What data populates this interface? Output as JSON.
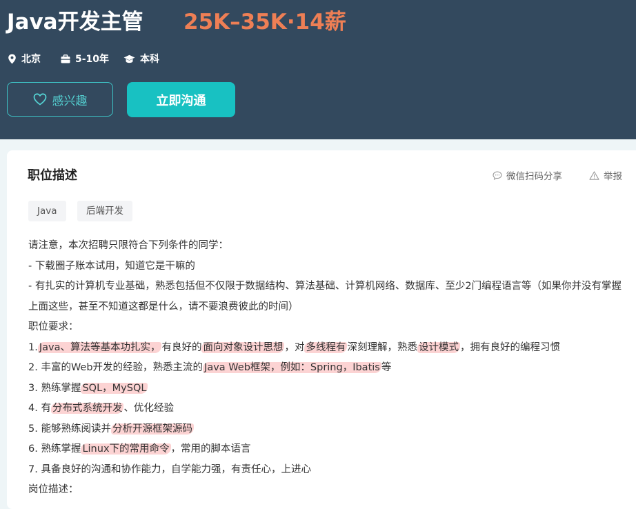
{
  "job": {
    "title": "Java开发主管",
    "salary": "25K–35K·14薪",
    "city": "北京",
    "experience": "5-10年",
    "education": "本科"
  },
  "buttons": {
    "interest_label": "感兴趣",
    "chat_label": "立即沟通"
  },
  "description": {
    "section_title": "职位描述",
    "share_label": "微信扫码分享",
    "report_label": "举报",
    "tags": [
      "Java",
      "后端开发"
    ],
    "notice_intro": "请注意，本次招聘只限符合下列条件的同学：",
    "notice_1": "- 下载圈子账本试用，知道它是干嘛的",
    "notice_2": "- 有扎实的计算机专业基础，熟悉包括但不仅限于数据结构、算法基础、计算机网络、数据库、至少2门编程语言等（如果你并没有掌握上面这些，甚至不知道这都是什么，请不要浪费彼此的时间）",
    "requirements_title": "职位要求：",
    "req1": {
      "prefix": "1.",
      "hl1": "Java、算法等基本功扎实，",
      "mid1": "有良好的",
      "hl2": "面向对象设计思想",
      "mid2": "，对",
      "hl3": "多线程有",
      "mid3": "深刻理解，熟悉",
      "hl4": "设计模式",
      "suffix": "，拥有良好的编程习惯"
    },
    "req2": {
      "prefix": "2. 丰富的Web开发的经验，熟悉主流的",
      "hl": "Java Web框架，例如：Spring，Ibatis",
      "suffix": "等"
    },
    "req3": {
      "prefix": "3. 熟练掌握",
      "hl": "SQL，MySQL",
      "suffix": ""
    },
    "req4": {
      "prefix": "4. 有",
      "hl": "分布式系统开发",
      "suffix": "、优化经验"
    },
    "req5": {
      "prefix": "5. 能够熟练阅读并",
      "hl": "分析开源框架源码",
      "suffix": ""
    },
    "req6": {
      "prefix": "6. 熟练掌握",
      "hl": "Linux下的常用命令",
      "suffix": "，常用的脚本语言"
    },
    "req7": "7. 具备良好的沟通和协作能力，自学能力强，有责任心，上进心",
    "duties_title": "岗位描述："
  },
  "colors": {
    "header_bg": "#33495e",
    "salary": "#ee7f55",
    "accent": "#18c1c2",
    "highlight": "#f89e9e"
  },
  "icons": [
    "location-pin-icon",
    "briefcase-icon",
    "graduation-cap-icon",
    "heart-icon",
    "chat-bubble-icon",
    "warning-triangle-icon"
  ]
}
